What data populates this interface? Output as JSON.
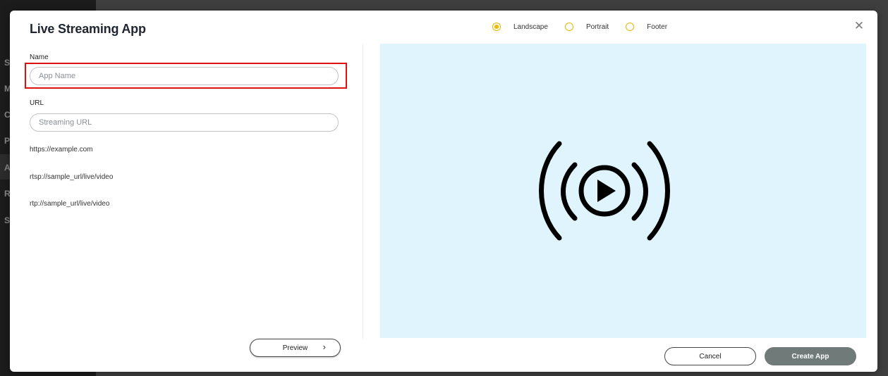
{
  "background": {
    "sidebar_letters": [
      "S",
      "M",
      "C",
      "P",
      "A",
      "R",
      "S"
    ]
  },
  "modal": {
    "title": "Live Streaming App",
    "orientation": {
      "options": [
        {
          "label": "Landscape",
          "selected": true
        },
        {
          "label": "Portrait",
          "selected": false
        },
        {
          "label": "Footer",
          "selected": false
        }
      ]
    },
    "name_field": {
      "label": "Name",
      "placeholder": "App Name",
      "value": ""
    },
    "url_field": {
      "label": "URL",
      "placeholder": "Streaming URL",
      "value": ""
    },
    "example_urls": [
      "https://example.com",
      "rtsp://sample_url/live/video",
      "rtp://sample_url/live/video"
    ],
    "preview_button": {
      "label": "Preview",
      "icon": "chevron-right-icon"
    },
    "cancel_button": {
      "label": "Cancel"
    },
    "create_button": {
      "label": "Create App"
    },
    "close_icon": "close-icon",
    "preview_icon": "live-stream-play-icon"
  },
  "colors": {
    "accent_radio": "#f0b800",
    "preview_bg": "#dff4fc",
    "create_button_bg": "#707b79",
    "highlight": "#e01010"
  }
}
